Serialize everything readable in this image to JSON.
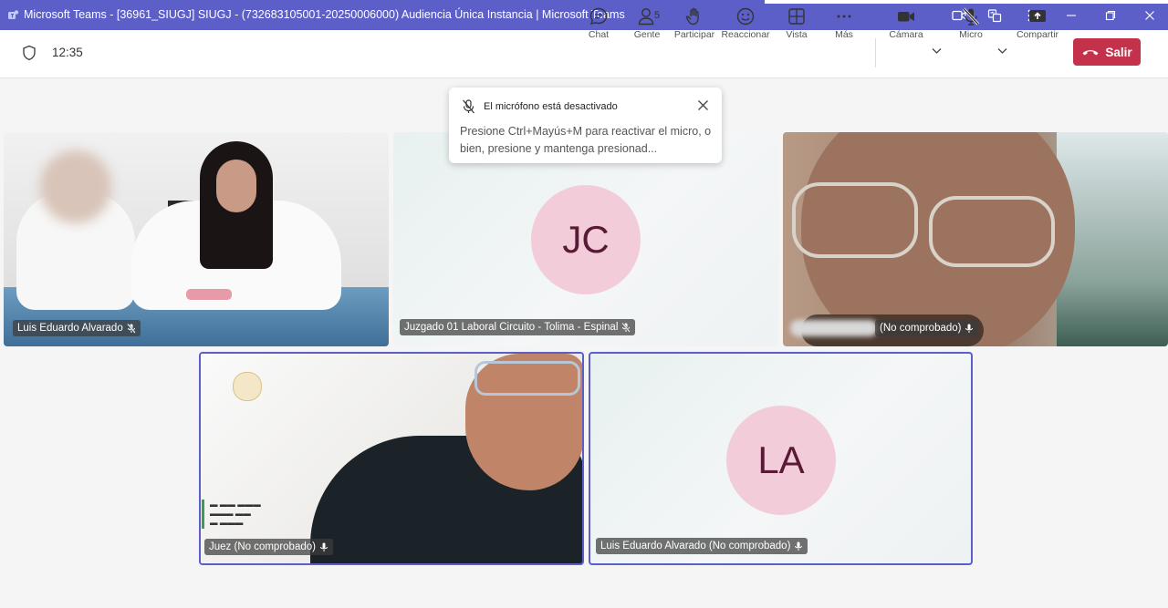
{
  "window": {
    "title": "Microsoft Teams - [36961_SIUGJ] SIUGJ - (732683105001-20250006000) Audiencia Única Instancia | Microsoft Teams"
  },
  "toolbar": {
    "time": "12:35",
    "chat_label": "Chat",
    "people_label": "Gente",
    "people_count": "5",
    "raise_label": "Participar",
    "react_label": "Reaccionar",
    "view_label": "Vista",
    "more_label": "Más",
    "camera_label": "Cámara",
    "mic_label": "Micro",
    "share_label": "Compartir",
    "leave_label": "Salir"
  },
  "notification": {
    "title": "El micrófono está desactivado",
    "body": "Presione Ctrl+Mayús+M para reactivar el micro, o bien, presione y mantenga presionad..."
  },
  "participants": [
    {
      "name": "Luis Eduardo Alvarado",
      "mic": "muted"
    },
    {
      "name": "Juzgado 01 Laboral Circuito - Tolima - Espinal",
      "initials": "JC",
      "mic": "muted"
    },
    {
      "name": "(No comprobado)",
      "mic": "on"
    },
    {
      "name": "Juez (No comprobado)",
      "mic": "on"
    },
    {
      "name": "Luis Eduardo Alvarado (No comprobado)",
      "initials": "LA",
      "mic": "on"
    }
  ],
  "colors": {
    "brand": "#5b5fc7",
    "leave": "#c4314b",
    "avatar_bg": "#f2cdd9",
    "avatar_text": "#5a1a36"
  }
}
